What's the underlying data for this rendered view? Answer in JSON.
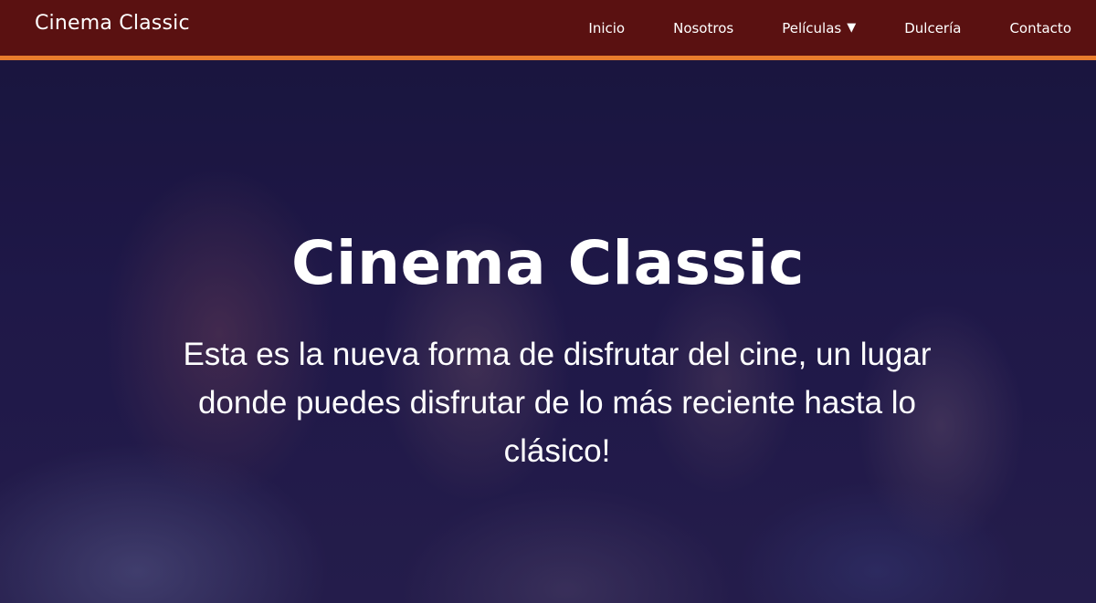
{
  "nav": {
    "brand": "Cinema Classic",
    "items": [
      {
        "label": "Inicio",
        "dropdown": false
      },
      {
        "label": "Nosotros",
        "dropdown": false
      },
      {
        "label": "Películas",
        "dropdown": true
      },
      {
        "label": "Dulcería",
        "dropdown": false
      },
      {
        "label": "Contacto",
        "dropdown": false
      }
    ],
    "caret": "▼"
  },
  "hero": {
    "title": "Cinema Classic",
    "subtitle": "Esta es la nueva forma de disfrutar del cine, un lugar donde puedes disfrutar de lo más reciente hasta lo clásico!"
  },
  "colors": {
    "nav_bg": "#5a1111",
    "nav_border": "#e87c2d",
    "hero_overlay": "#1c1740",
    "text": "#ffffff"
  }
}
